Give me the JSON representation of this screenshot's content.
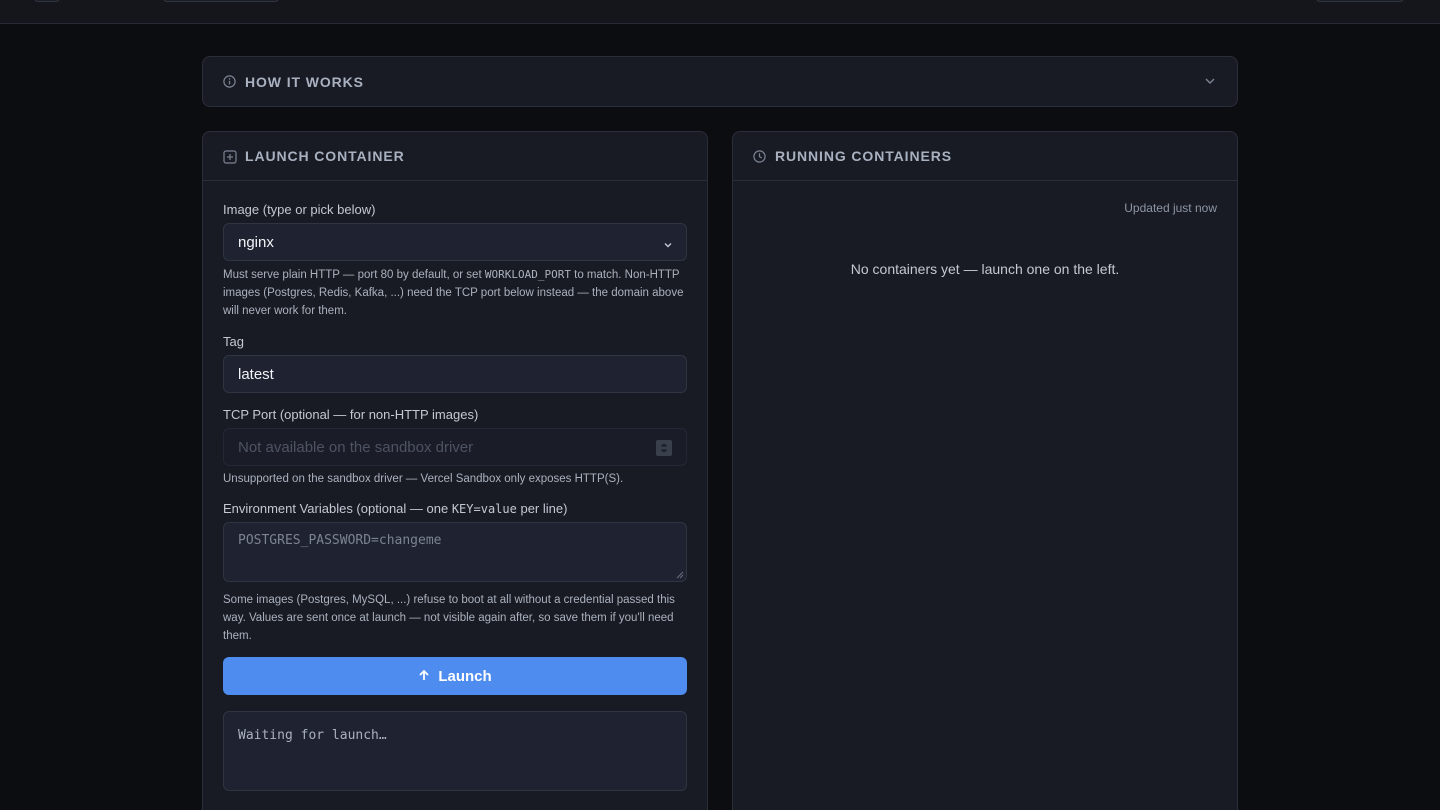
{
  "how_it_works": {
    "title": "HOW IT WORKS"
  },
  "launch": {
    "title": "LAUNCH CONTAINER",
    "image_label": "Image (type or pick below)",
    "image_value": "nginx",
    "image_help_1": "Must serve plain HTTP — port 80 by default, or set ",
    "image_help_code": "WORKLOAD_PORT",
    "image_help_2": " to match. Non-HTTP images (Postgres, Redis, Kafka, ...) need the TCP port below instead — the domain above will never work for them.",
    "tag_label": "Tag",
    "tag_value": "latest",
    "port_label": "TCP Port (optional — for non-HTTP images)",
    "port_placeholder": "Not available on the sandbox driver",
    "port_help": "Unsupported on the sandbox driver — Vercel Sandbox only exposes HTTP(S).",
    "env_label_1": "Environment Variables (optional — one ",
    "env_label_code": "KEY=value",
    "env_label_2": " per line)",
    "env_placeholder": "POSTGRES_PASSWORD=changeme",
    "env_help": "Some images (Postgres, MySQL, ...) refuse to boot at all without a credential passed this way. Values are sent once at launch — not visible again after, so save them if you'll need them.",
    "button_label": "Launch",
    "log_text": "Waiting for launch…"
  },
  "running": {
    "title": "RUNNING CONTAINERS",
    "updated": "Updated just now",
    "empty_message": "No containers yet — launch one on the left."
  },
  "colors": {
    "accent": "#4e8cf0",
    "background": "#0c0d10",
    "panel": "#181b24"
  },
  "icons": [
    "info-icon",
    "chevron-down-icon",
    "plus-square-icon",
    "clock-icon",
    "arrow-up-icon",
    "stepper-icon"
  ]
}
